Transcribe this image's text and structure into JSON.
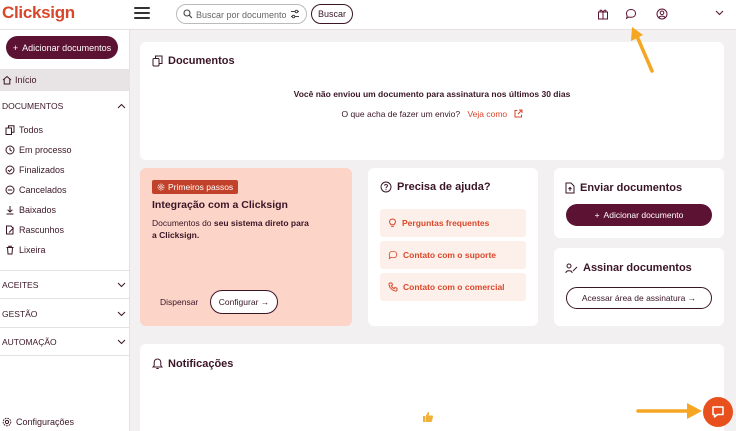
{
  "header": {
    "logo": "Clicksign",
    "search_placeholder": "Buscar por documento",
    "search_button": "Buscar"
  },
  "sidebar": {
    "add_document": "Adicionar documentos",
    "home": "Início",
    "sections": [
      {
        "title": "DOCUMENTOS"
      },
      {
        "title": "ACEITES"
      },
      {
        "title": "GESTÃO"
      },
      {
        "title": "AUTOMAÇÃO"
      }
    ],
    "doc_items": [
      "Todos",
      "Em processo",
      "Finalizados",
      "Cancelados",
      "Baixados",
      "Rascunhos",
      "Lixeira"
    ],
    "settings": "Configurações"
  },
  "documents_card": {
    "title": "Documentos",
    "empty_message": "Você não enviou um documento para assinatura nos últimos 30 dias",
    "feedback_question": "O que acha de fazer um envio?",
    "feedback_link": "Veja como"
  },
  "onboarding": {
    "badge": "Primeiros passos",
    "title": "Integração com a Clicksign",
    "desc_prefix": "Documentos do",
    "desc_bold": "seu sistema direto para a Clicksign.",
    "dismiss": "Dispensar",
    "configure": "Configurar →"
  },
  "help": {
    "title": "Precisa de ajuda?",
    "links": [
      "Perguntas frequentes",
      "Contato com o suporte",
      "Contato com o comercial"
    ]
  },
  "send": {
    "title": "Enviar documentos",
    "button": "Adicionar documento"
  },
  "sign": {
    "title": "Assinar documentos",
    "button": "Acessar área de assinatura →"
  },
  "notifications": {
    "title": "Notificações"
  },
  "colors": {
    "brand": "#d9472b",
    "primary": "#5c1232",
    "annotation_arrow": "#f5a623",
    "chat": "#e8501e"
  }
}
